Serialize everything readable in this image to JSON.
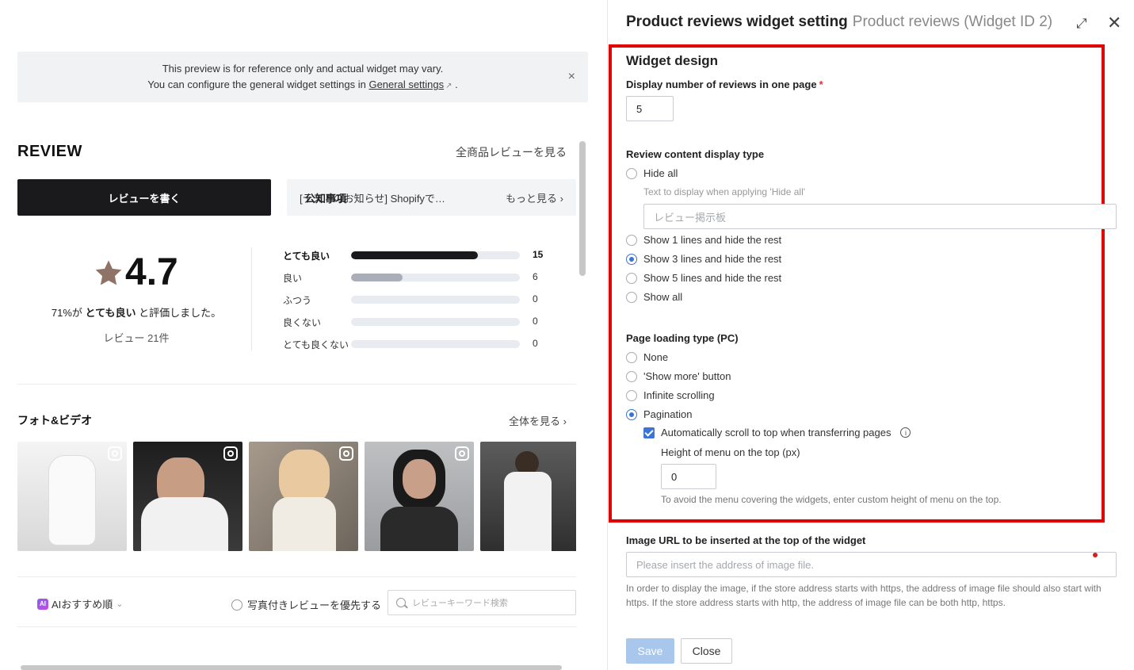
{
  "preview": {
    "notice_line1": "This preview is for reference only and actual widget may vary.",
    "notice_line2_prefix": "You can configure the general widget settings in",
    "notice_link": "General settings",
    "notice_line2_suffix": ".",
    "notice_close": "×",
    "widget_title": "REVIEW",
    "all_reviews_link": "全商品レビューを見る",
    "write_review_button": "レビューを書く",
    "announcement_label": "公知事項",
    "announcement_text": "[テストのお知らせ] Shopifyで…",
    "announcement_more": "もっと見る ›",
    "score": "4.7",
    "score_desc_prefix": "71%が",
    "score_desc_bold": "とても良い",
    "score_desc_suffix": "と評価しました。",
    "review_count": "レビュー 21件",
    "distribution": [
      {
        "label": "とても良い",
        "count": "15",
        "fraction": 0.71,
        "bold": true
      },
      {
        "label": "良い",
        "count": "6",
        "fraction": 0.29,
        "bold": false
      },
      {
        "label": "ふつう",
        "count": "0",
        "fraction": 0,
        "bold": false
      },
      {
        "label": "良くない",
        "count": "0",
        "fraction": 0,
        "bold": false
      },
      {
        "label": "とても良くない",
        "count": "0",
        "fraction": 0,
        "bold": false
      }
    ],
    "photo_section_title": "フォト&ビデオ",
    "photo_all_link": "全体を見る ›",
    "sort_label": "AIおすすめ順",
    "sort_chevron": "⌄",
    "ai_badge": "AI",
    "photo_first_label": "写真付きレビューを優先する",
    "search_placeholder": "レビューキーワード検索"
  },
  "panel": {
    "title": "Product reviews widget setting",
    "subtitle": "Product reviews (Widget ID 2)",
    "expand_icon": "⤢",
    "close_icon": "✕",
    "section_title": "Widget design",
    "reviews_per_page_label": "Display number of reviews in one page",
    "required_mark": "*",
    "reviews_per_page_value": "5",
    "content_display_label": "Review content display type",
    "content_display_options": [
      {
        "label": "Hide all",
        "selected": false
      },
      {
        "label": "Show 1 lines and hide the rest",
        "selected": false
      },
      {
        "label": "Show 3 lines and hide the rest",
        "selected": true
      },
      {
        "label": "Show 5 lines and hide the rest",
        "selected": false
      },
      {
        "label": "Show all",
        "selected": false
      }
    ],
    "hide_all_hint": "Text to display when applying 'Hide all'",
    "hide_all_placeholder": "レビュー掲示板",
    "page_loading_label": "Page loading type (PC)",
    "page_loading_options": [
      {
        "label": "None",
        "selected": false
      },
      {
        "label": "'Show more' button",
        "selected": false
      },
      {
        "label": "Infinite scrolling",
        "selected": false
      },
      {
        "label": "Pagination",
        "selected": true
      }
    ],
    "auto_scroll_label": "Automatically scroll to top when transferring pages",
    "auto_scroll_checked": true,
    "info_icon": "i",
    "menu_height_label": "Height of menu on the top (px)",
    "menu_height_value": "0",
    "menu_height_hint": "To avoid the menu covering the widgets, enter custom height of menu on the top.",
    "image_url_label": "Image URL to be inserted at the top of the widget",
    "image_url_placeholder": "Please insert the address of image file.",
    "image_url_note": "In order to display the image, if the store address starts with https, the address of image file should also start with https. If the store address starts with http, the address of image file can be both http, https.",
    "save_button": "Save",
    "close_button": "Close"
  },
  "colors": {
    "accent": "#3b74d4",
    "highlight_box": "#e00000",
    "save_disabled": "#a9c7ec",
    "star": "#8f7366"
  }
}
